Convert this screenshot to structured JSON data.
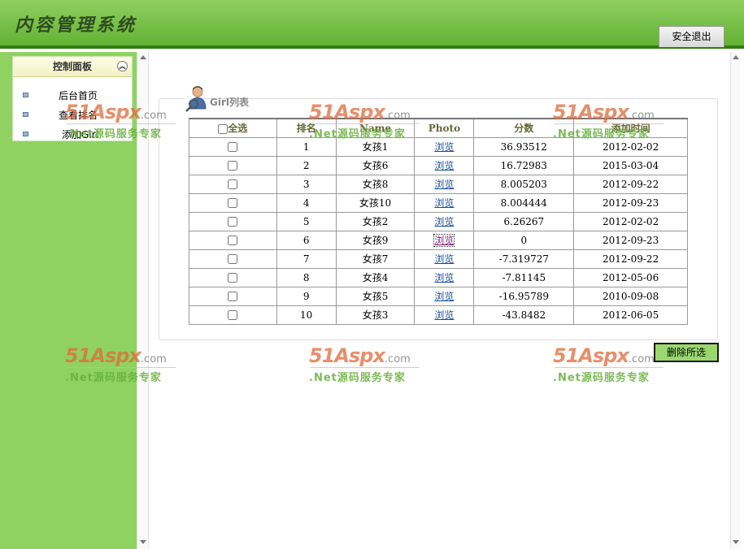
{
  "header": {
    "title": "内容管理系统",
    "logout_label": "安全退出"
  },
  "sidebar": {
    "panel_title": "控制面板",
    "items": [
      {
        "label": "后台首页"
      },
      {
        "label": "查看排名"
      },
      {
        "label": "添加Girl"
      }
    ]
  },
  "main": {
    "section_title": "Girl列表",
    "table": {
      "headers": {
        "select_all": "全选",
        "rank": "排名",
        "name": "Name",
        "photo": "Photo",
        "score": "分数",
        "added": "添加时间"
      },
      "rows": [
        {
          "rank": "1",
          "name": "女孩1",
          "photo": "浏览",
          "score": "36.93512",
          "added": "2012-02-02"
        },
        {
          "rank": "2",
          "name": "女孩6",
          "photo": "浏览",
          "score": "16.72983",
          "added": "2015-03-04"
        },
        {
          "rank": "3",
          "name": "女孩8",
          "photo": "浏览",
          "score": "8.005203",
          "added": "2012-09-22"
        },
        {
          "rank": "4",
          "name": "女孩10",
          "photo": "浏览",
          "score": "8.004444",
          "added": "2012-09-23"
        },
        {
          "rank": "5",
          "name": "女孩2",
          "photo": "浏览",
          "score": "6.26267",
          "added": "2012-02-02"
        },
        {
          "rank": "6",
          "name": "女孩9",
          "photo": "浏览",
          "score": "0",
          "added": "2012-09-23"
        },
        {
          "rank": "7",
          "name": "女孩7",
          "photo": "浏览",
          "score": "-7.319727",
          "added": "2012-09-22"
        },
        {
          "rank": "8",
          "name": "女孩4",
          "photo": "浏览",
          "score": "-7.81145",
          "added": "2012-05-06"
        },
        {
          "rank": "9",
          "name": "女孩5",
          "photo": "浏览",
          "score": "-16.95789",
          "added": "2010-09-08"
        },
        {
          "rank": "10",
          "name": "女孩3",
          "photo": "浏览",
          "score": "-43.8482",
          "added": "2012-06-05"
        }
      ]
    },
    "delete_label": "删除所选"
  },
  "watermark": {
    "main": "51Aspx",
    "suffix": ".com",
    "sub": ".Net源码服务专家"
  },
  "colors": {
    "header_green": "#63b234",
    "sidebar_green": "#8fd261",
    "link_blue": "#1a4f9c"
  }
}
